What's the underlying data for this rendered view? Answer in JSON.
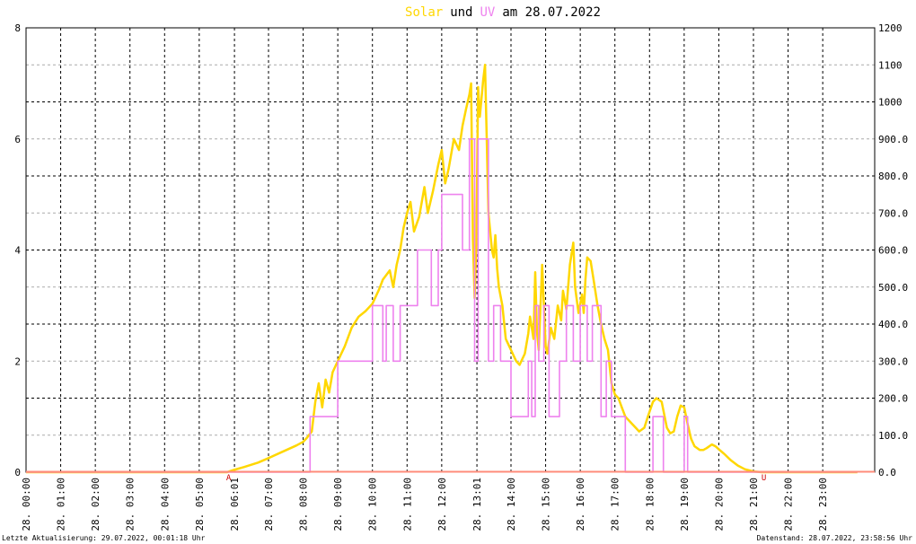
{
  "chart_data": {
    "type": "line",
    "title": {
      "solar": "Solar",
      "und": "und",
      "uv": "UV",
      "rest": "am 28.07.2022"
    },
    "left_axis": {
      "min": 0,
      "max": 8,
      "ticks": [
        "0",
        "2",
        "4",
        "6",
        "8"
      ]
    },
    "right_axis": {
      "min": 0,
      "max": 1200,
      "ticks": [
        "0.0",
        "100.0",
        "200.0",
        "300.0",
        "400.0",
        "500.0",
        "600.0",
        "700.0",
        "800.0",
        "900.0",
        "1000",
        "1100",
        "1200"
      ]
    },
    "x_axis": {
      "min_hour": 0,
      "max_hour": 24.5,
      "ticks": [
        {
          "h": 0,
          "label": "28. 00:00"
        },
        {
          "h": 1,
          "label": "28. 01:00"
        },
        {
          "h": 2,
          "label": "28. 02:00"
        },
        {
          "h": 3,
          "label": "28. 03:00"
        },
        {
          "h": 4,
          "label": "28. 04:00"
        },
        {
          "h": 5,
          "label": "28. 05:00"
        },
        {
          "h": 6.017,
          "label": "28. 06:01"
        },
        {
          "h": 7,
          "label": "28. 07:00"
        },
        {
          "h": 8,
          "label": "28. 08:00"
        },
        {
          "h": 9,
          "label": "28. 09:00"
        },
        {
          "h": 10,
          "label": "28. 10:00"
        },
        {
          "h": 11,
          "label": "28. 11:00"
        },
        {
          "h": 12,
          "label": "28. 12:00"
        },
        {
          "h": 13.017,
          "label": "28. 13:01"
        },
        {
          "h": 14,
          "label": "28. 14:00"
        },
        {
          "h": 15,
          "label": "28. 15:00"
        },
        {
          "h": 16,
          "label": "28. 16:00"
        },
        {
          "h": 17,
          "label": "28. 17:00"
        },
        {
          "h": 18,
          "label": "28. 18:00"
        },
        {
          "h": 19,
          "label": "28. 19:00"
        },
        {
          "h": 20,
          "label": "28. 20:00"
        },
        {
          "h": 21,
          "label": "28. 21:00"
        },
        {
          "h": 22,
          "label": "28. 22:00"
        },
        {
          "h": 23,
          "label": "28. 23:00"
        }
      ]
    },
    "markers": [
      {
        "h": 5.85,
        "label": "A"
      },
      {
        "h": 21.3,
        "label": "U"
      }
    ],
    "grid": true,
    "series": [
      {
        "name": "Solar",
        "axis": "right",
        "color": "#ffd700",
        "points": [
          [
            0,
            0
          ],
          [
            5.8,
            0
          ],
          [
            6.0,
            6
          ],
          [
            6.3,
            14
          ],
          [
            6.7,
            26
          ],
          [
            7.0,
            38
          ],
          [
            7.4,
            55
          ],
          [
            7.8,
            72
          ],
          [
            8.0,
            82
          ],
          [
            8.1,
            92
          ],
          [
            8.25,
            110
          ],
          [
            8.35,
            190
          ],
          [
            8.45,
            240
          ],
          [
            8.55,
            175
          ],
          [
            8.65,
            250
          ],
          [
            8.75,
            215
          ],
          [
            8.85,
            270
          ],
          [
            9.0,
            300
          ],
          [
            9.2,
            340
          ],
          [
            9.4,
            390
          ],
          [
            9.6,
            420
          ],
          [
            9.8,
            435
          ],
          [
            10.0,
            455
          ],
          [
            10.2,
            495
          ],
          [
            10.3,
            520
          ],
          [
            10.5,
            545
          ],
          [
            10.6,
            500
          ],
          [
            10.7,
            560
          ],
          [
            10.8,
            600
          ],
          [
            10.9,
            660
          ],
          [
            11.0,
            700
          ],
          [
            11.1,
            730
          ],
          [
            11.2,
            650
          ],
          [
            11.35,
            690
          ],
          [
            11.5,
            770
          ],
          [
            11.6,
            700
          ],
          [
            11.75,
            760
          ],
          [
            11.9,
            830
          ],
          [
            12.0,
            870
          ],
          [
            12.1,
            780
          ],
          [
            12.2,
            820
          ],
          [
            12.35,
            900
          ],
          [
            12.5,
            870
          ],
          [
            12.6,
            935
          ],
          [
            12.7,
            980
          ],
          [
            12.8,
            1020
          ],
          [
            12.85,
            1050
          ],
          [
            12.9,
            630
          ],
          [
            12.95,
            470
          ],
          [
            13.0,
            620
          ],
          [
            13.05,
            1040
          ],
          [
            13.1,
            960
          ],
          [
            13.2,
            1060
          ],
          [
            13.25,
            1100
          ],
          [
            13.3,
            900
          ],
          [
            13.35,
            700
          ],
          [
            13.45,
            600
          ],
          [
            13.5,
            580
          ],
          [
            13.55,
            640
          ],
          [
            13.6,
            550
          ],
          [
            13.65,
            500
          ],
          [
            13.75,
            450
          ],
          [
            13.85,
            360
          ],
          [
            14.0,
            330
          ],
          [
            14.15,
            300
          ],
          [
            14.25,
            290
          ],
          [
            14.4,
            320
          ],
          [
            14.5,
            375
          ],
          [
            14.55,
            420
          ],
          [
            14.65,
            360
          ],
          [
            14.7,
            540
          ],
          [
            14.75,
            380
          ],
          [
            14.8,
            330
          ],
          [
            14.9,
            560
          ],
          [
            15.0,
            340
          ],
          [
            15.05,
            320
          ],
          [
            15.15,
            390
          ],
          [
            15.25,
            360
          ],
          [
            15.35,
            450
          ],
          [
            15.45,
            410
          ],
          [
            15.5,
            490
          ],
          [
            15.6,
            440
          ],
          [
            15.7,
            560
          ],
          [
            15.8,
            620
          ],
          [
            15.85,
            500
          ],
          [
            15.95,
            430
          ],
          [
            16.05,
            480
          ],
          [
            16.1,
            430
          ],
          [
            16.15,
            520
          ],
          [
            16.2,
            580
          ],
          [
            16.3,
            570
          ],
          [
            16.4,
            510
          ],
          [
            16.5,
            450
          ],
          [
            16.6,
            400
          ],
          [
            16.7,
            360
          ],
          [
            16.8,
            330
          ],
          [
            16.9,
            240
          ],
          [
            17.0,
            210
          ],
          [
            17.1,
            200
          ],
          [
            17.2,
            175
          ],
          [
            17.3,
            150
          ],
          [
            17.5,
            130
          ],
          [
            17.6,
            120
          ],
          [
            17.7,
            110
          ],
          [
            17.85,
            120
          ],
          [
            17.95,
            150
          ],
          [
            18.1,
            190
          ],
          [
            18.2,
            200
          ],
          [
            18.35,
            190
          ],
          [
            18.5,
            120
          ],
          [
            18.6,
            105
          ],
          [
            18.7,
            110
          ],
          [
            18.8,
            150
          ],
          [
            18.9,
            180
          ],
          [
            19.0,
            175
          ],
          [
            19.1,
            130
          ],
          [
            19.2,
            90
          ],
          [
            19.3,
            70
          ],
          [
            19.45,
            60
          ],
          [
            19.55,
            60
          ],
          [
            19.65,
            65
          ],
          [
            19.8,
            75
          ],
          [
            19.9,
            70
          ],
          [
            20.0,
            62
          ],
          [
            20.15,
            50
          ],
          [
            20.35,
            32
          ],
          [
            20.55,
            18
          ],
          [
            20.75,
            8
          ],
          [
            21.0,
            2
          ],
          [
            21.25,
            0
          ],
          [
            24.0,
            0
          ]
        ]
      },
      {
        "name": "UV",
        "axis": "left",
        "color": "#ee82ee",
        "points": [
          [
            0,
            0
          ],
          [
            8.2,
            0
          ],
          [
            8.2,
            1
          ],
          [
            9.0,
            1
          ],
          [
            9.0,
            2
          ],
          [
            10.0,
            2
          ],
          [
            10.0,
            3
          ],
          [
            10.3,
            3
          ],
          [
            10.3,
            2
          ],
          [
            10.4,
            2
          ],
          [
            10.4,
            3
          ],
          [
            10.6,
            3
          ],
          [
            10.6,
            2
          ],
          [
            10.8,
            2
          ],
          [
            10.8,
            3
          ],
          [
            11.3,
            3
          ],
          [
            11.3,
            4
          ],
          [
            11.7,
            4
          ],
          [
            11.7,
            3
          ],
          [
            11.9,
            3
          ],
          [
            11.9,
            4
          ],
          [
            12.0,
            4
          ],
          [
            12.0,
            5
          ],
          [
            12.6,
            5
          ],
          [
            12.6,
            4
          ],
          [
            12.8,
            4
          ],
          [
            12.8,
            6
          ],
          [
            12.95,
            6
          ],
          [
            12.95,
            2
          ],
          [
            13.05,
            2
          ],
          [
            13.05,
            6
          ],
          [
            13.35,
            6
          ],
          [
            13.35,
            2
          ],
          [
            13.5,
            2
          ],
          [
            13.5,
            3
          ],
          [
            13.7,
            3
          ],
          [
            13.7,
            2
          ],
          [
            14.0,
            2
          ],
          [
            14.0,
            1
          ],
          [
            14.5,
            1
          ],
          [
            14.5,
            2
          ],
          [
            14.6,
            2
          ],
          [
            14.6,
            1
          ],
          [
            14.7,
            1
          ],
          [
            14.7,
            3
          ],
          [
            14.8,
            3
          ],
          [
            14.8,
            2
          ],
          [
            14.95,
            2
          ],
          [
            14.95,
            3
          ],
          [
            15.1,
            3
          ],
          [
            15.1,
            1
          ],
          [
            15.4,
            1
          ],
          [
            15.4,
            2
          ],
          [
            15.6,
            2
          ],
          [
            15.6,
            3
          ],
          [
            15.8,
            3
          ],
          [
            15.8,
            2
          ],
          [
            16.0,
            2
          ],
          [
            16.0,
            3
          ],
          [
            16.2,
            3
          ],
          [
            16.2,
            2
          ],
          [
            16.35,
            2
          ],
          [
            16.35,
            3
          ],
          [
            16.6,
            3
          ],
          [
            16.6,
            1
          ],
          [
            16.75,
            1
          ],
          [
            16.75,
            2
          ],
          [
            16.9,
            2
          ],
          [
            16.9,
            1
          ],
          [
            17.3,
            1
          ],
          [
            17.3,
            0
          ],
          [
            18.1,
            0
          ],
          [
            18.1,
            1
          ],
          [
            18.4,
            1
          ],
          [
            18.4,
            0
          ],
          [
            19.0,
            0
          ],
          [
            19.0,
            1
          ],
          [
            19.1,
            1
          ],
          [
            19.1,
            0
          ],
          [
            24.0,
            0
          ]
        ]
      }
    ]
  },
  "footer": {
    "left": "Letzte Aktualisierung: 29.07.2022, 00:01:18 Uhr",
    "right": "Datenstand: 28.07.2022, 23:58:56 Uhr"
  },
  "colors": {
    "solar": "#ffd700",
    "uv": "#ee82ee",
    "baseline": "#ff8c7a",
    "marker": "#cc0000"
  }
}
